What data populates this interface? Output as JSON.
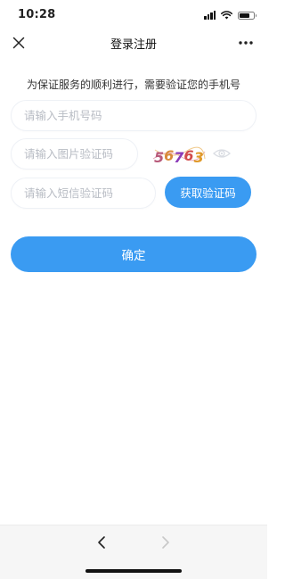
{
  "status_bar": {
    "time": "10:28",
    "icons": [
      "signal-icon",
      "wifi-icon",
      "battery-icon"
    ]
  },
  "nav_bar": {
    "title": "登录注册",
    "close_icon": "close-icon",
    "more_icon": "more-icon"
  },
  "form": {
    "hint": "为保证服务的顺利进行，需要验证您的手机号",
    "phone_placeholder": "请输入手机号码",
    "image_code_placeholder": "请输入图片验证码",
    "captcha_text": "56763",
    "sms_code_placeholder": "请输入短信验证码",
    "get_code_label": "获取验证码",
    "confirm_label": "确定"
  },
  "bottom_bar": {
    "icons": [
      "back-arrow-icon",
      "forward-arrow-icon"
    ]
  },
  "colors": {
    "accent": "#3a9bf2",
    "placeholder": "#b8bcc4",
    "field_border": "#eef1f6",
    "captcha_colors": [
      "#b85a7a",
      "#d98a3a",
      "#8a3ab8",
      "#d14b4b",
      "#e09a2a"
    ]
  }
}
